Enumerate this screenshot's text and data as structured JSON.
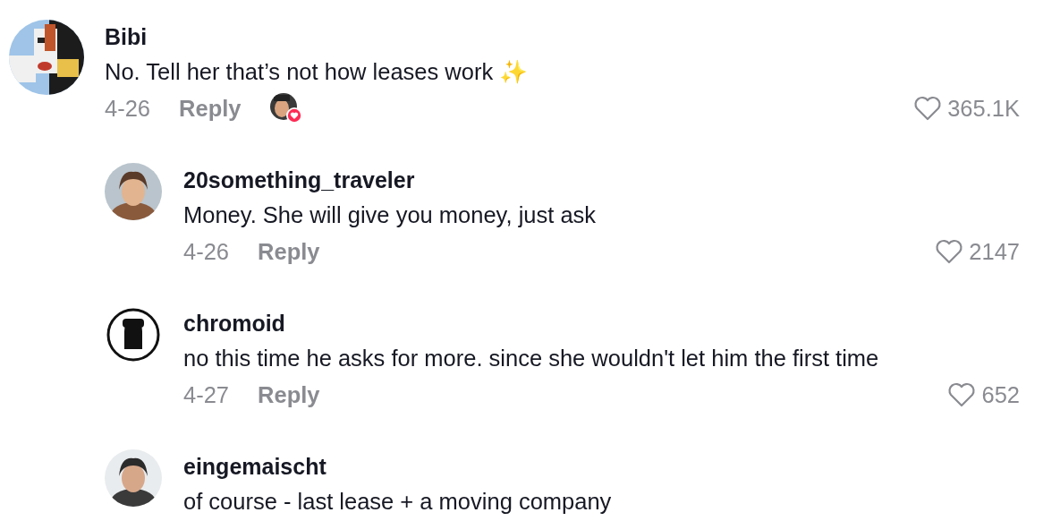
{
  "comments": [
    {
      "name": "Bibi",
      "text": "No. Tell her that’s not how leases work ✨",
      "date": "4-26",
      "reply_label": "Reply",
      "creator_liked": true,
      "likes": "365.1K",
      "replies": [
        {
          "name": "20something_traveler",
          "text": "Money. She will give you money, just ask",
          "date": "4-26",
          "reply_label": "Reply",
          "likes": "2147"
        },
        {
          "name": "chromoid",
          "text": "no this time he asks for more. since she wouldn't let him the first time",
          "date": "4-27",
          "reply_label": "Reply",
          "likes": "652"
        },
        {
          "name": "eingemaischt",
          "text": "of course - last lease + a moving company"
        }
      ]
    }
  ]
}
